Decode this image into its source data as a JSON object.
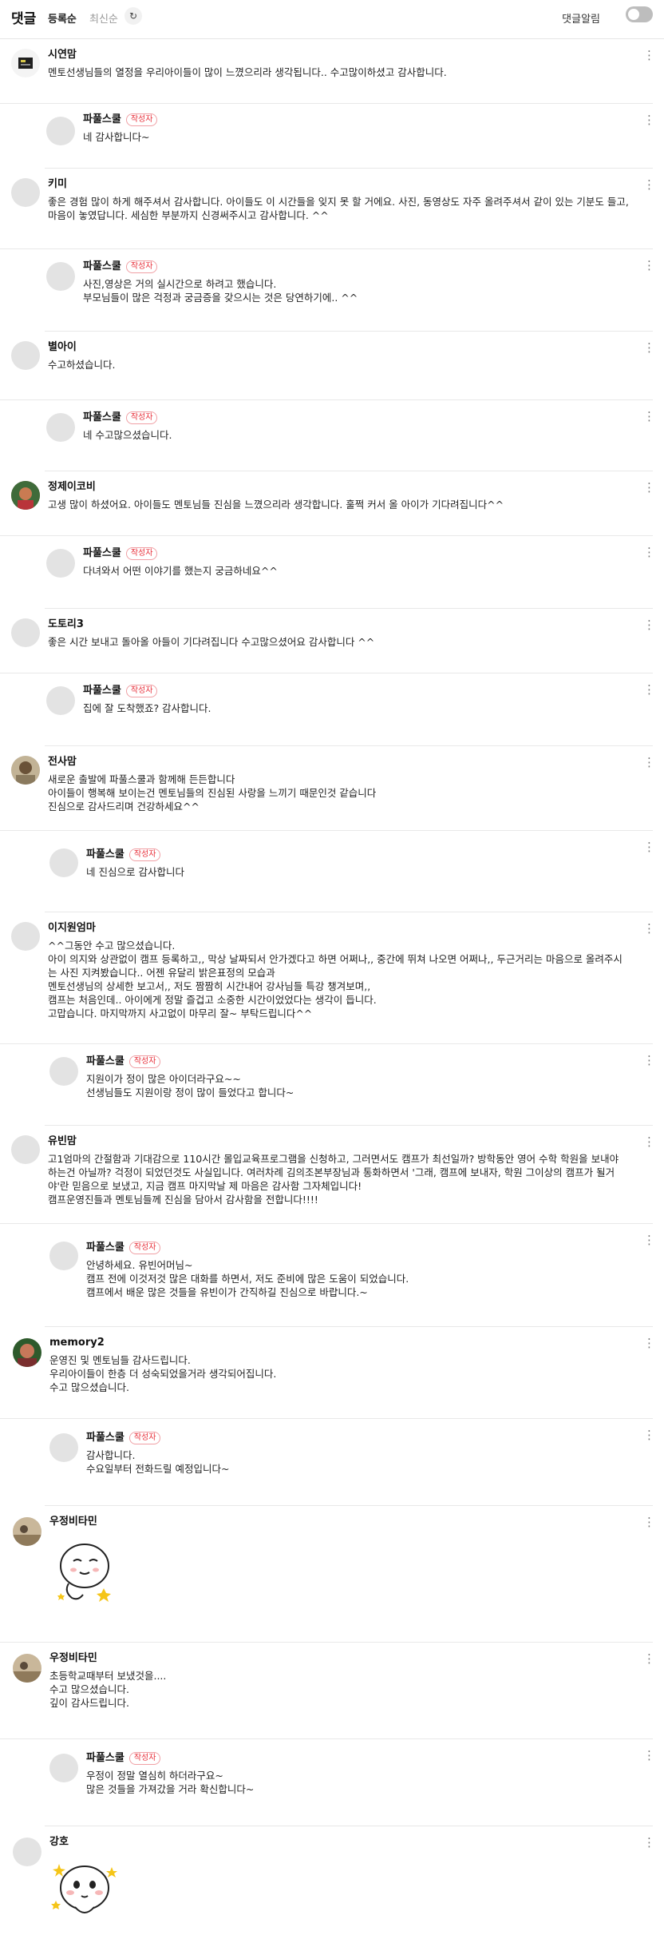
{
  "header": {
    "title": "댓글",
    "sort_registered": "등록순",
    "sort_latest": "최신순",
    "notify_label": "댓글알림",
    "notify_on": false
  },
  "badge_label": "작성자",
  "comments": [
    {
      "author": "시연맘",
      "text": "멘토선생님들의 열정을 우리아이들이 많이 느꼈으리라 생각됩니다.. 수고많이하셨고 감사합니다."
    },
    {
      "author": "파풀스쿨",
      "text": "네 감사합니다~"
    },
    {
      "author": "키미",
      "text": "좋은 경험 많이 하게 해주셔서 감사합니다. 아이들도 이 시간들을 잊지 못 할 거에요. 사진, 동영상도 자주 올려주셔서 같이 있는 기분도 들고, 마음이 놓였답니다. 세심한 부분까지 신경써주시고 감사합니다. ^^"
    },
    {
      "author": "파풀스쿨",
      "text": "사진,영상은 거의 실시간으로 하려고 했습니다.\n부모님들이 많은 걱정과 궁금증을 갖으시는 것은 당연하기에.. ^^"
    },
    {
      "author": "별아이",
      "text": "수고하셨습니다."
    },
    {
      "author": "파풀스쿨",
      "text": "네 수고많으셨습니다."
    },
    {
      "author": "정제이코비",
      "text": "고생 많이 하셨어요. 아이들도 멘토님들 진심을 느꼈으리라 생각합니다. 훌쩍 커서 올 아이가 기다려집니다^^"
    },
    {
      "author": "파풀스쿨",
      "text": "다녀와서 어떤 이야기를 했는지 궁금하네요^^"
    },
    {
      "author": "도토리3",
      "text": "좋은 시간 보내고 돌아올 아들이 기다려집니다 수고많으셨어요 감사합니다 ^^"
    },
    {
      "author": "파풀스쿨",
      "text": "집에 잘 도착했죠? 감사합니다."
    },
    {
      "author": "전사맘",
      "text": "새로운 출발에 파풀스쿨과 함께해 든든합니다\n아이들이 행복해 보이는건 멘토님들의 진심된 사랑을 느끼기 때문인것 같습니다\n진심으로 감사드리며 건강하세요^^"
    },
    {
      "author": "파풀스쿨",
      "text": "네 진심으로 감사합니다"
    },
    {
      "author": "이지원엄마",
      "text": "^^그동안 수고 많으셨습니다.\n아이 의지와 상관없이 캠프 등록하고,, 막상 날짜되서 안가겠다고 하면 어쩌나,, 중간에 뛰쳐 나오면 어쩌나,, 두근거리는 마음으로 올려주시는 사진 지켜봤습니다.. 어젠 유달리 밝은표정의 모습과\n멘토선생님의 상세한 보고서,, 저도 짬짬히 시간내어 강사님들 특강 챙겨보며,,\n캠프는 처음인데.. 아이에게 정말 즐겁고 소중한 시간이었었다는 생각이 듭니다.\n고맙습니다. 마지막까지 사고없이 마무리 잘~ 부탁드립니다^^"
    },
    {
      "author": "파풀스쿨",
      "text": "지원이가 정이 많은 아이더라구요~~\n선생님들도 지원이랑 정이 많이 들었다고 합니다~"
    },
    {
      "author": "유빈맘",
      "text": "고1엄마의 간절함과 기대감으로 110시간 몰입교육프로그램을 신청하고, 그러면서도 캠프가 최선일까? 방학동안 영어 수학 학원을 보내야 하는건 아닐까? 걱정이 되었던것도 사실입니다. 여러차례 김의조본부장님과 통화하면서 '그래, 캠프에 보내자, 학원 그이상의 캠프가 될거야'란 믿음으로 보냈고, 지금 캠프 마지막날 제 마음은 감사함 그자체입니다!\n캠프운영진들과 멘토님들께 진심을 담아서 감사함을 전합니다!!!!"
    },
    {
      "author": "파풀스쿨",
      "text": "안녕하세요. 유빈어머님~\n캠프 전에 이것저것 많은 대화를 하면서, 저도 준비에 많은 도움이 되었습니다.\n캠프에서 배운 많은 것들을 유빈이가 간직하길 진심으로 바랍니다.~"
    },
    {
      "author": "memory2",
      "text": "운영진 및 멘토님들 감사드립니다.\n우리아이들이 한층 더 성숙되었을거라 생각되어집니다.\n수고 많으셨습니다."
    },
    {
      "author": "파풀스쿨",
      "text": "감사합니다.\n수요일부터 전화드릴 예정입니다~"
    },
    {
      "author": "우정비타민",
      "text": ""
    },
    {
      "author": "우정비타민",
      "text": "초등학교때부터 보냈것을....\n수고 많으셨습니다.\n깊이 감사드립니다."
    },
    {
      "author": "파풀스쿨",
      "text": "우정이 정말 열심히 하더라구요~\n많은 것들을 가져갔을 거라 확신합니다~"
    },
    {
      "author": "강호",
      "text": ""
    }
  ]
}
